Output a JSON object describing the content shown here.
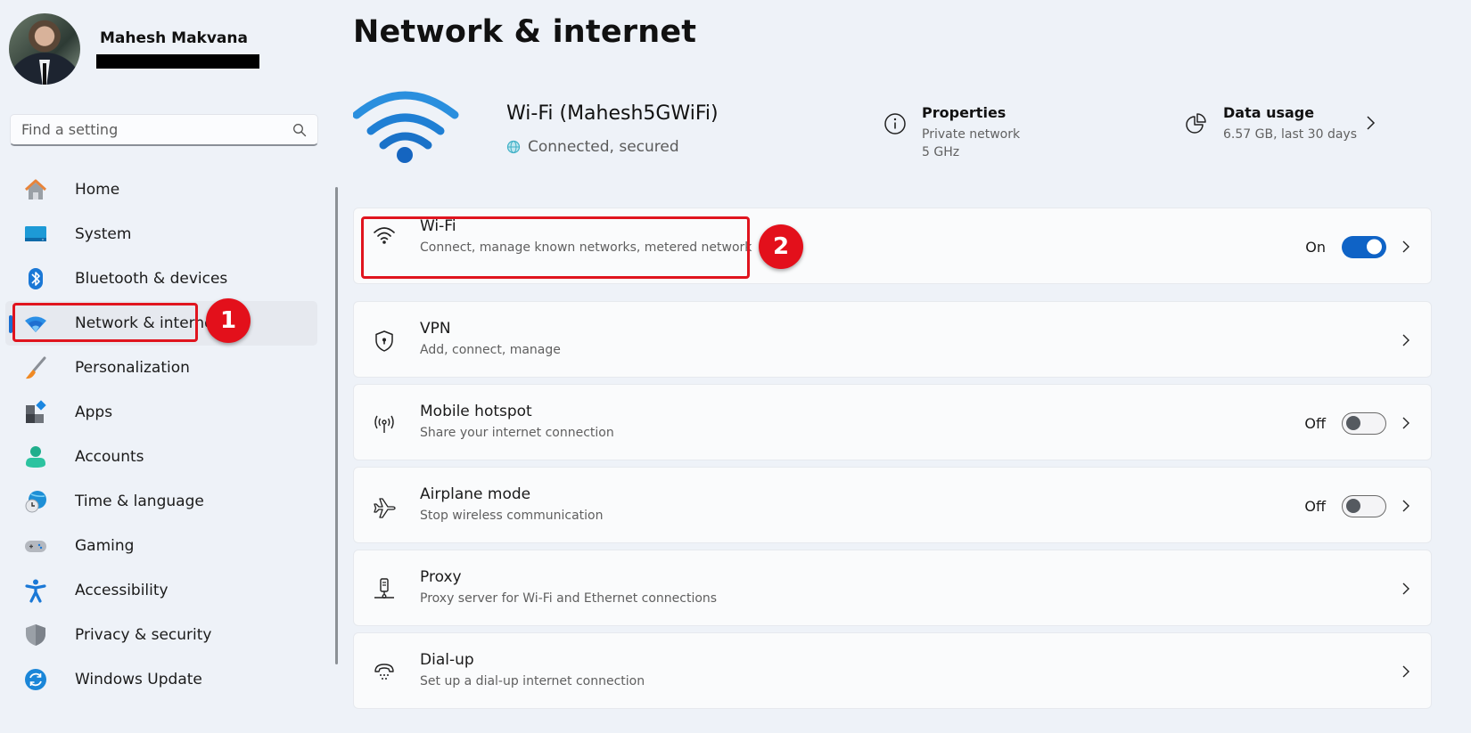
{
  "profile": {
    "name": "Mahesh Makvana",
    "email_redacted": true
  },
  "search": {
    "placeholder": "Find a setting",
    "value": ""
  },
  "sidebar": {
    "items": [
      {
        "label": "Home",
        "icon": "home-icon",
        "active": false
      },
      {
        "label": "System",
        "icon": "system-icon",
        "active": false
      },
      {
        "label": "Bluetooth & devices",
        "icon": "bluetooth-icon",
        "active": false
      },
      {
        "label": "Network & internet",
        "icon": "network-icon",
        "active": true
      },
      {
        "label": "Personalization",
        "icon": "brush-icon",
        "active": false
      },
      {
        "label": "Apps",
        "icon": "apps-icon",
        "active": false
      },
      {
        "label": "Accounts",
        "icon": "accounts-icon",
        "active": false
      },
      {
        "label": "Time & language",
        "icon": "time-language-icon",
        "active": false
      },
      {
        "label": "Gaming",
        "icon": "gamepad-icon",
        "active": false
      },
      {
        "label": "Accessibility",
        "icon": "accessibility-icon",
        "active": false
      },
      {
        "label": "Privacy & security",
        "icon": "shield-icon",
        "active": false
      },
      {
        "label": "Windows Update",
        "icon": "windows-update-icon",
        "active": false
      }
    ]
  },
  "page": {
    "title": "Network & internet"
  },
  "hero": {
    "network_name": "Wi-Fi (Mahesh5GWiFi)",
    "status": "Connected, secured",
    "properties": {
      "title": "Properties",
      "line1": "Private network",
      "line2": "5 GHz"
    },
    "data_usage": {
      "title": "Data usage",
      "line1": "6.57 GB, last 30 days"
    }
  },
  "cards": [
    {
      "title": "Wi-Fi",
      "subtitle": "Connect, manage known networks, metered network",
      "icon": "wifi-icon",
      "toggle": "On",
      "toggle_state": true
    },
    {
      "title": "VPN",
      "subtitle": "Add, connect, manage",
      "icon": "vpn-shield-icon",
      "toggle": null
    },
    {
      "title": "Mobile hotspot",
      "subtitle": "Share your internet connection",
      "icon": "hotspot-icon",
      "toggle": "Off",
      "toggle_state": false
    },
    {
      "title": "Airplane mode",
      "subtitle": "Stop wireless communication",
      "icon": "airplane-icon",
      "toggle": "Off",
      "toggle_state": false
    },
    {
      "title": "Proxy",
      "subtitle": "Proxy server for Wi-Fi and Ethernet connections",
      "icon": "proxy-icon",
      "toggle": null
    },
    {
      "title": "Dial-up",
      "subtitle": "Set up a dial-up internet connection",
      "icon": "dialup-icon",
      "toggle": null
    }
  ],
  "callouts": [
    {
      "number": "1",
      "target": "Network & internet"
    },
    {
      "number": "2",
      "target": "Wi-Fi"
    }
  ],
  "colors": {
    "accent": "#0f63c6",
    "callout_red": "#e3101b",
    "background": "#eef2f8"
  }
}
